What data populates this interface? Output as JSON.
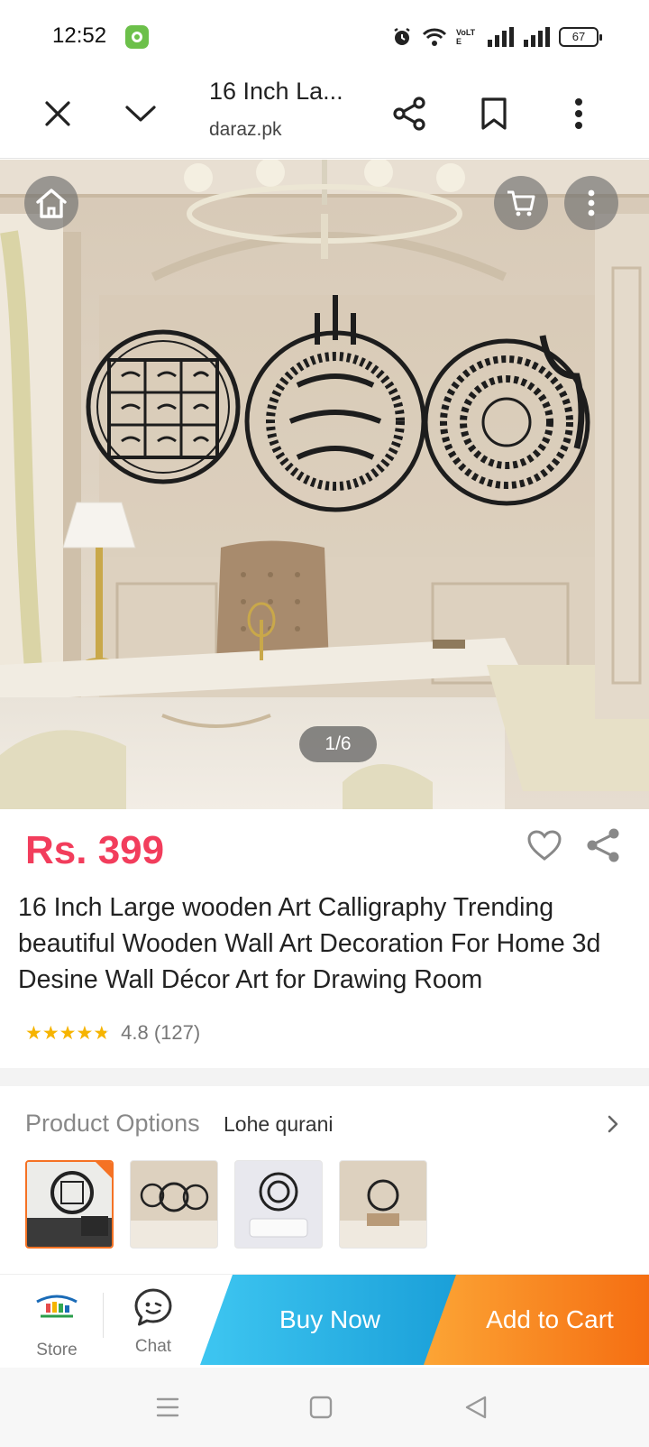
{
  "status_bar": {
    "time": "12:52",
    "battery": "67",
    "network_label": "VoLTE"
  },
  "browser": {
    "title": "16 Inch La...",
    "domain": "daraz.pk"
  },
  "hero": {
    "counter": "1/6"
  },
  "product": {
    "price": "Rs. 399",
    "title": "16 Inch Large wooden Art Calligraphy Trending beautiful Wooden Wall Art Decoration For Home 3d Desine Wall Décor Art for Drawing Room",
    "rating_value": "4.8",
    "rating_count": "(127)",
    "rating_stars": 4.8
  },
  "options": {
    "label": "Product Options",
    "value": "Lohe qurani"
  },
  "actions": {
    "store": "Store",
    "chat": "Chat",
    "buy_now": "Buy Now",
    "add_to_cart": "Add to Cart"
  },
  "colors": {
    "price": "#f23d5c",
    "buy_now": "#1fa8e0",
    "add_to_cart": "#f57224",
    "stars": "#f6b400"
  },
  "icons": [
    "close-icon",
    "chevron-down-icon",
    "share-icon",
    "bookmark-icon",
    "more-vert-icon",
    "home-icon",
    "cart-icon",
    "heart-icon",
    "chevron-right-icon",
    "chat-icon",
    "menu-icon",
    "square-icon",
    "back-triangle-icon"
  ]
}
